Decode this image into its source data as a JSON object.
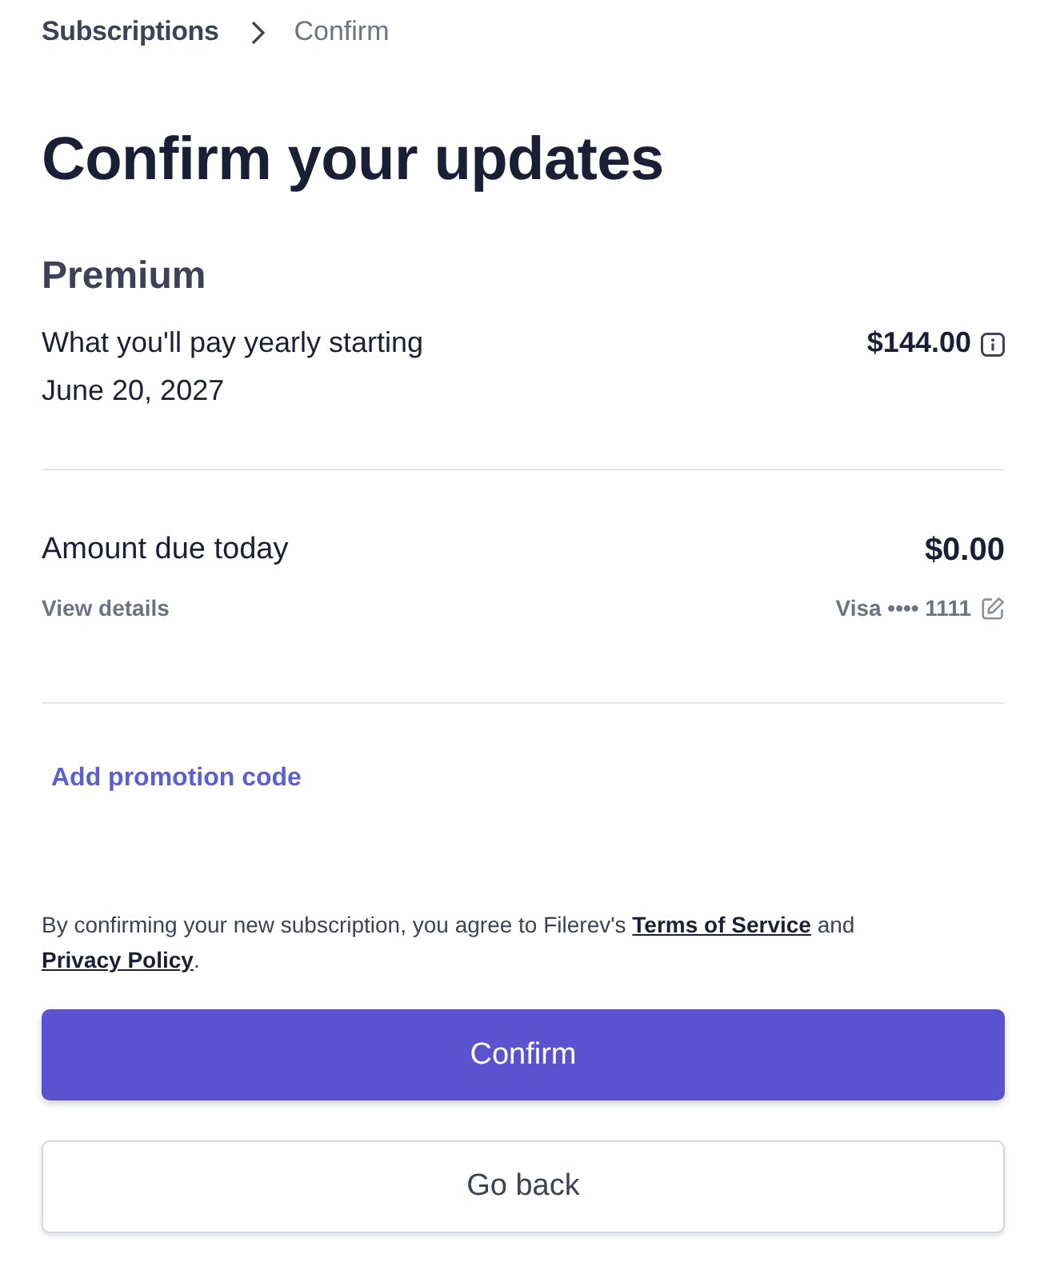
{
  "breadcrumb": {
    "items": [
      {
        "label": "Subscriptions",
        "current": false
      },
      {
        "label": "Confirm",
        "current": true
      }
    ]
  },
  "title": "Confirm your updates",
  "plan": {
    "name": "Premium",
    "description": "What you'll pay yearly starting June 20, 2027",
    "price": "$144.00"
  },
  "due": {
    "label": "Amount due today",
    "amount": "$0.00",
    "details_link": "View details",
    "payment_method": "Visa •••• 1111"
  },
  "promotion_link": "Add promotion code",
  "legal": {
    "parts": [
      {
        "kind": "text",
        "text": "By confirming your new subscription, you agree to Filerev's"
      },
      {
        "kind": "link",
        "text": "Terms of Service"
      },
      {
        "kind": "text",
        "text": "and"
      },
      {
        "kind": "link",
        "text": "Privacy Policy"
      },
      {
        "kind": "punct",
        "text": "."
      }
    ]
  },
  "buttons": [
    {
      "label": "Confirm",
      "kind": "primary"
    },
    {
      "label": "Go back",
      "kind": "secondary"
    }
  ]
}
